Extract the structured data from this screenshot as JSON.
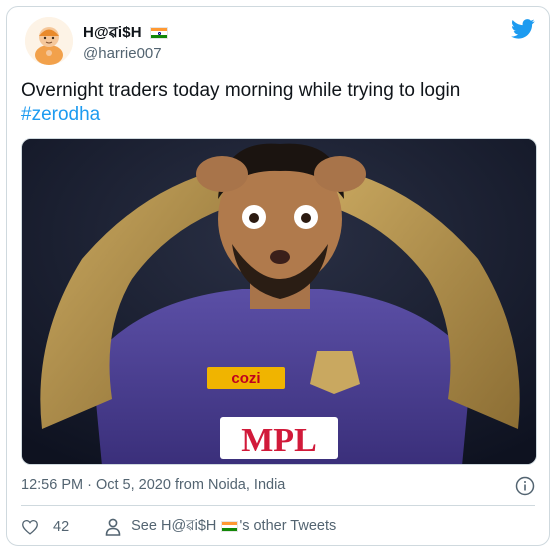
{
  "author": {
    "name": "H@ৱi$H",
    "handle": "@harrie007"
  },
  "tweet": {
    "text": "Overnight traders today morning while trying to login",
    "hashtag": "#zerodha"
  },
  "image": {
    "description": "Cricketer in purple KKR jersey holding his head with both hands, wide-eyed",
    "jersey_text_1": "cozi",
    "jersey_text_2": "MPL"
  },
  "meta": {
    "timestamp": "12:56 PM · Oct 5, 2020 from Noida, India"
  },
  "actions": {
    "like_count": "42",
    "see_prefix": "See H@ৱi$H",
    "see_suffix": "'s other Tweets"
  },
  "icons": {
    "brand": "twitter-bird-icon",
    "like": "heart-icon",
    "profile": "person-icon",
    "info": "info-icon"
  },
  "colors": {
    "twitter_blue": "#1d9bf0",
    "secondary_text": "#536471",
    "border": "#cfd9de"
  }
}
